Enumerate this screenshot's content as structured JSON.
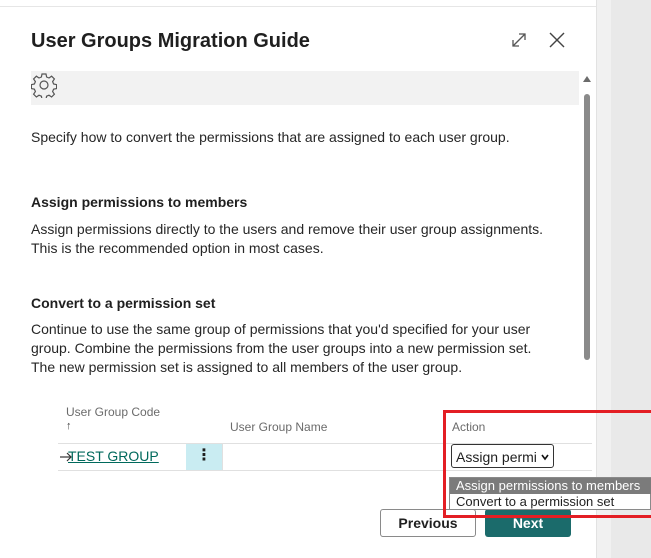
{
  "dialog": {
    "title": "User Groups Migration Guide"
  },
  "intro": "Specify how to convert the permissions that are assigned to each user group.",
  "options": [
    {
      "heading": "Assign permissions to members",
      "lines": [
        "Assign permissions directly to the users and remove their user group assignments.",
        "This is the recommended option in most cases."
      ]
    },
    {
      "heading": "Convert to a permission set",
      "lines": [
        "Continue to use the same group of permissions that you'd specified for your user",
        "group. Combine the permissions from the user groups into a new permission set.",
        "The new permission set is assigned to all members of the user group."
      ]
    }
  ],
  "grid": {
    "headers": {
      "code": "User Group Code",
      "code_sort": "↑",
      "name": "User Group Name",
      "action": "Action"
    },
    "rows": [
      {
        "code": "TEST GROUP",
        "name": "",
        "menu": "⋮",
        "action": "Assign permi"
      }
    ]
  },
  "dropdown": {
    "options": [
      "Assign permissions to members",
      "Convert to a permission set"
    ]
  },
  "buttons": {
    "previous": "Previous",
    "next": "Next"
  },
  "colors": {
    "accent": "#1b6b6b",
    "link": "#00695c",
    "highlight": "#e31e24",
    "selected_cell": "#c9ecf2"
  }
}
